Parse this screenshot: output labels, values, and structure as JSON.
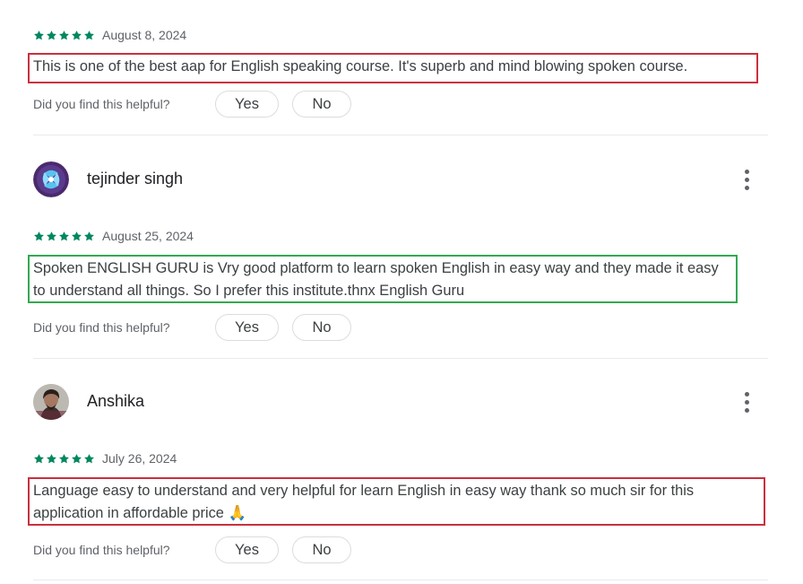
{
  "colors": {
    "star": "#01875f",
    "highlight_red": "#c8313f",
    "highlight_green": "#34a853"
  },
  "reviews": [
    {
      "author": "",
      "rating": 5,
      "date": "August 8, 2024",
      "text": "This is one of the best aap for English speaking course. It's superb and mind blowing spoken course.",
      "highlight": "red",
      "helpful_prompt": "Did you find this helpful?",
      "yes_label": "Yes",
      "no_label": "No"
    },
    {
      "author": "tejinder singh",
      "avatar_icon": "avatar-abstract-blue",
      "more_icon": "more-vert-icon",
      "rating": 5,
      "date": "August 25, 2024",
      "text": "Spoken ENGLISH GURU is Vry good platform to learn spoken English in easy way and they made it easy to understand all things. So I prefer this institute.thnx English Guru",
      "highlight": "green",
      "helpful_prompt": "Did you find this helpful?",
      "yes_label": "Yes",
      "no_label": "No"
    },
    {
      "author": "Anshika",
      "avatar_icon": "avatar-photo",
      "more_icon": "more-vert-icon",
      "rating": 5,
      "date": "July 26, 2024",
      "text": "Language easy to understand and very helpful for learn English in easy way thank so much sir for this application in affordable price 🙏",
      "highlight": "red",
      "helpful_prompt": "Did you find this helpful?",
      "yes_label": "Yes",
      "no_label": "No"
    }
  ]
}
